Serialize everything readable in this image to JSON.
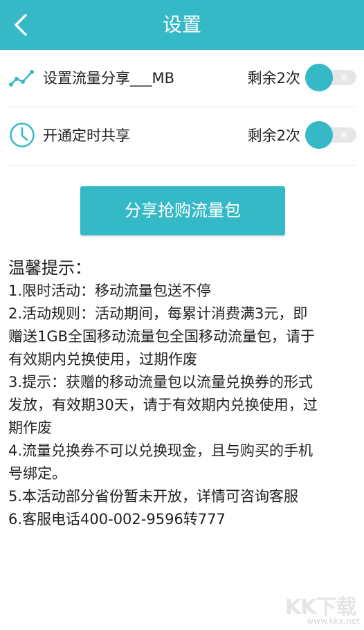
{
  "header": {
    "title": "设置",
    "back_icon": "chevron-left-icon"
  },
  "settings": [
    {
      "icon": "trend-line-icon",
      "label": "设置流量分享___MB",
      "remaining": "剩余2次",
      "toggle_text": "关",
      "enabled": false
    },
    {
      "icon": "clock-icon",
      "label": "开通定时共享",
      "remaining": "剩余2次",
      "toggle_text": "关",
      "enabled": false
    }
  ],
  "share_button": {
    "label": "分享抢购流量包"
  },
  "tips": {
    "title": "温馨提示：",
    "lines": [
      "1.限时活动：移动流量包送不停",
      "2.活动规则：活动期间，每累计消费满3元，即",
      "赠送1GB全国移动流量包全国移动流量包，请于",
      "有效期内兑换使用，过期作废",
      "3.提示：获赠的移动流量包以流量兑换券的形式",
      "发放，有效期30天，请于有效期内兑换使用，过",
      "期作废",
      "4.流量兑换券不可以兑换现金，且与购买的手机",
      "号绑定。",
      "5.本活动部分省份暂未开放，详情可咨询客服",
      "6.客服电话400-002-9596转777"
    ]
  },
  "watermark": {
    "text": "KK下载",
    "url": "www.kkx.net"
  },
  "colors": {
    "accent": "#35b9c6",
    "text": "#222222",
    "toggle_track": "#e6e6e6"
  }
}
